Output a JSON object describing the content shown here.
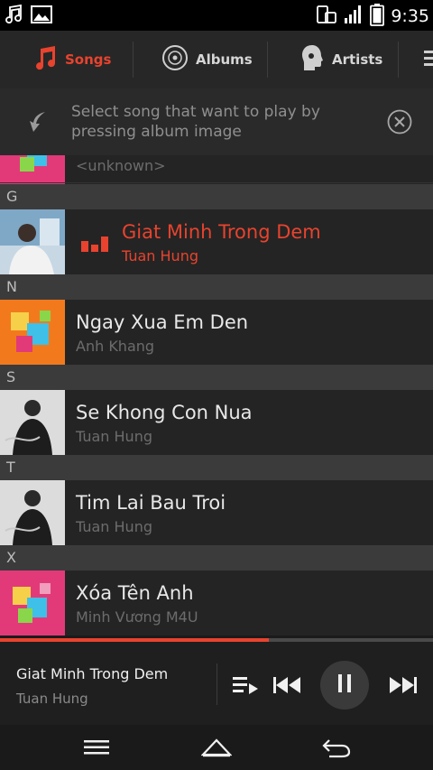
{
  "status_bar": {
    "time": "9:35",
    "icons": [
      "music-note-icon",
      "image-icon",
      "phone-rotate-icon",
      "signal-icon",
      "battery-icon"
    ]
  },
  "tabs": [
    {
      "label": "Songs",
      "icon": "music-note-icon",
      "active": true
    },
    {
      "label": "Albums",
      "icon": "disc-icon",
      "active": false
    },
    {
      "label": "Artists",
      "icon": "artist-head-icon",
      "active": false
    }
  ],
  "hint": {
    "text": "Select song that want to play by pressing album image"
  },
  "list": {
    "partial_row": {
      "artist": "<unknown>"
    },
    "sections": [
      {
        "letter": "G",
        "song": {
          "title": "Giat Minh Trong Dem",
          "artist": "Tuan Hung",
          "playing": true
        }
      },
      {
        "letter": "N",
        "song": {
          "title": "Ngay Xua Em Den",
          "artist": "Anh Khang"
        }
      },
      {
        "letter": "S",
        "song": {
          "title": "Se Khong Con Nua",
          "artist": "Tuan Hung"
        }
      },
      {
        "letter": "T",
        "song": {
          "title": "Tim Lai Bau Troi",
          "artist": "Tuan Hung"
        }
      },
      {
        "letter": "X",
        "song": {
          "title": "Xóa Tên Anh",
          "artist": "Minh Vương M4U"
        }
      }
    ]
  },
  "now_playing": {
    "title": "Giat Minh Trong Dem",
    "artist": "Tuan Hung",
    "progress": 0.62
  },
  "colors": {
    "accent": "#e8432e",
    "background": "#1b1b1b",
    "row": "#242424",
    "section": "#3b3b3b"
  }
}
